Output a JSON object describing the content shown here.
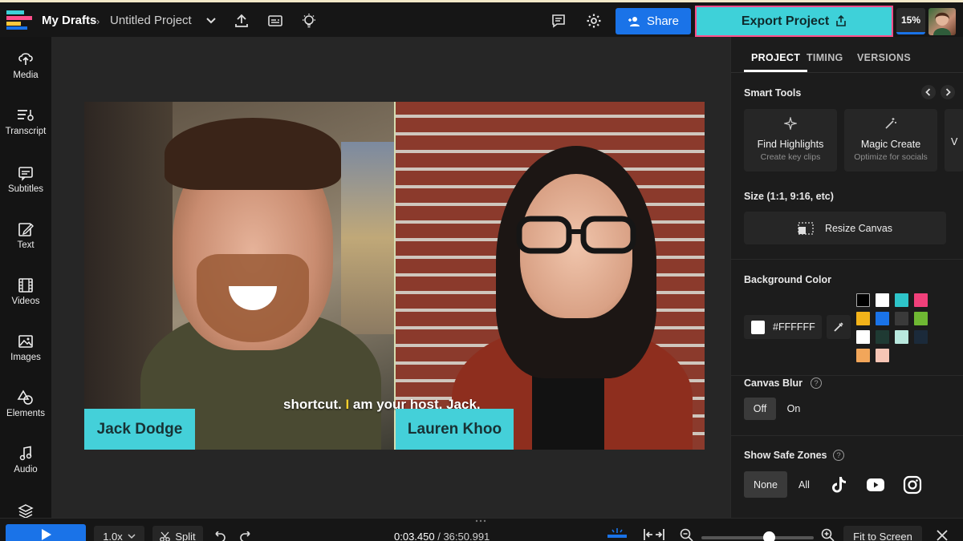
{
  "header": {
    "breadcrumb_root": "My Drafts",
    "breadcrumb_sep": "›",
    "project_title": "Untitled Project",
    "share_label": "Share",
    "export_label": "Export Project",
    "progress_label": "15%",
    "progress": 0.15,
    "colors": {
      "share": "#1a73e8",
      "export": "#3ed1d9",
      "export_border": "#ff4f8b"
    }
  },
  "sidebar": {
    "items": [
      {
        "label": "Media",
        "icon": "upload-icon"
      },
      {
        "label": "Transcript",
        "icon": "transcript-icon"
      },
      {
        "label": "Subtitles",
        "icon": "subtitles-icon"
      },
      {
        "label": "Text",
        "icon": "text-edit-icon"
      },
      {
        "label": "Videos",
        "icon": "film-icon"
      },
      {
        "label": "Images",
        "icon": "image-icon"
      },
      {
        "label": "Elements",
        "icon": "shapes-icon"
      },
      {
        "label": "Audio",
        "icon": "music-note-icon"
      }
    ]
  },
  "canvas": {
    "caption_before": "shortcut. ",
    "caption_highlight": "I",
    "caption_after": " am your host, Jack,",
    "left_name": "Jack Dodge",
    "right_name": "Lauren Khoo"
  },
  "panel": {
    "tabs": [
      "PROJECT",
      "TIMING",
      "VERSIONS"
    ],
    "smart_tools_title": "Smart Tools",
    "tools": [
      {
        "title": "Find Highlights",
        "subtitle": "Create key clips"
      },
      {
        "title": "Magic Create",
        "subtitle": "Optimize for socials"
      },
      {
        "title": "V",
        "subtitle": ""
      }
    ],
    "size_title": "Size (1:1, 9:16, etc)",
    "resize_label": "Resize Canvas",
    "bg_title": "Background Color",
    "bg_hex": "#FFFFFF",
    "swatches": [
      "#000000",
      "#ffffff",
      "#2ec4c9",
      "#f0407a",
      "#f2b31a",
      "#1a73e8",
      "#3a3a3a",
      "#6fb833",
      "#ffffff",
      "#1f3a33",
      "#b9e8de",
      "#1b2a3a",
      "#f2a65a",
      "#f6c5b5"
    ],
    "blur_title": "Canvas Blur",
    "blur_off": "Off",
    "blur_on": "On",
    "help_glyph": "?",
    "safe_title": "Show Safe Zones",
    "safe_none": "None",
    "safe_all": "All"
  },
  "bottom": {
    "speed": "1.0x",
    "split": "Split",
    "time_current": "0:03.450",
    "time_sep": " / ",
    "time_total": "36:50.991",
    "fit_label": "Fit to Screen",
    "zoom": 0.6
  }
}
